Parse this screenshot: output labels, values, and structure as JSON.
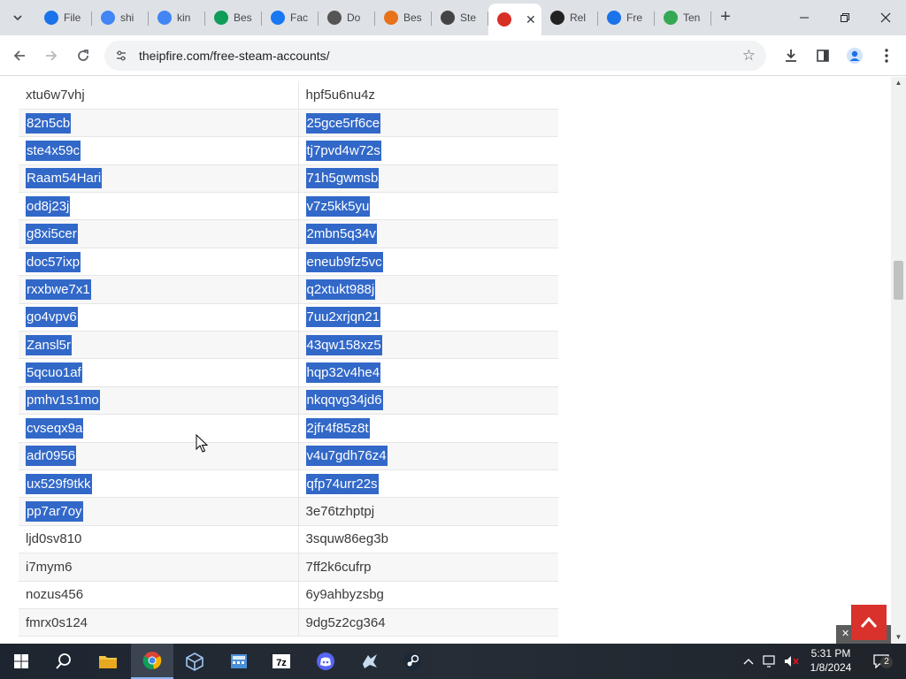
{
  "browser": {
    "tabs": [
      {
        "title": "File",
        "icon": "lightning-icon",
        "color": "#1a73e8"
      },
      {
        "title": "shi",
        "icon": "google-icon",
        "color": "#4285f4"
      },
      {
        "title": "kin",
        "icon": "google-icon",
        "color": "#4285f4"
      },
      {
        "title": "Bes",
        "icon": "app-icon",
        "color": "#0f9d58"
      },
      {
        "title": "Fac",
        "icon": "facebook-icon",
        "color": "#1877f2"
      },
      {
        "title": "Do",
        "icon": "shield-icon",
        "color": "#555555"
      },
      {
        "title": "Bes",
        "icon": "diamond-icon",
        "color": "#e8711a"
      },
      {
        "title": "Ste",
        "icon": "steam-icon",
        "color": "#444444"
      },
      {
        "title": "",
        "icon": "fire-icon",
        "color": "#d93025",
        "active": true
      },
      {
        "title": "Rel",
        "icon": "github-icon",
        "color": "#222222"
      },
      {
        "title": "Fre",
        "icon": "sms-icon",
        "color": "#1a73e8"
      },
      {
        "title": "Ten",
        "icon": "circle-icon",
        "color": "#34a853"
      }
    ],
    "url": "theipfire.com/free-steam-accounts/"
  },
  "accounts": [
    {
      "user": "xtu6w7vhj",
      "pass": "hpf5u6nu4z",
      "selected": false
    },
    {
      "user": "82n5cb",
      "pass": "25gce5rf6ce",
      "selected": true
    },
    {
      "user": "ste4x59c",
      "pass": "tj7pvd4w72s",
      "selected": true
    },
    {
      "user": "Raam54Hari",
      "pass": "71h5gwmsb",
      "selected": true
    },
    {
      "user": "od8j23j",
      "pass": "v7z5kk5yu",
      "selected": true
    },
    {
      "user": "g8xi5cer",
      "pass": "2mbn5q34v",
      "selected": true
    },
    {
      "user": "doc57ixp",
      "pass": "eneub9fz5vc",
      "selected": true
    },
    {
      "user": "rxxbwe7x1",
      "pass": "q2xtukt988j",
      "selected": true
    },
    {
      "user": "go4vpv6",
      "pass": "7uu2xrjqn21",
      "selected": true
    },
    {
      "user": "Zansl5r",
      "pass": "43qw158xz5",
      "selected": true
    },
    {
      "user": "5qcuo1af",
      "pass": "hqp32v4he4",
      "selected": true
    },
    {
      "user": "pmhv1s1mo",
      "pass": "nkqqvg34jd6",
      "selected": true
    },
    {
      "user": "cvseqx9a",
      "pass": "2jfr4f85z8t",
      "selected": true
    },
    {
      "user": "adr0956",
      "pass": "v4u7gdh76z4",
      "selected": true
    },
    {
      "user": "ux529f9tkk",
      "pass": "qfp74urr22s",
      "selected": true
    },
    {
      "user": "pp7ar7oy",
      "pass": "3e76tzhptpj",
      "selected": "user"
    },
    {
      "user": "ljd0sv810",
      "pass": "3squw86eg3b",
      "selected": false
    },
    {
      "user": "i7mym6",
      "pass": "7ff2k6cufrp",
      "selected": false
    },
    {
      "user": "nozus456",
      "pass": "6y9ahbyzsbg",
      "selected": false
    },
    {
      "user": "fmrx0s124",
      "pass": "9dg5z2cg364",
      "selected": false
    }
  ],
  "taskbar": {
    "time": "5:31 PM",
    "date": "1/8/2024",
    "notifications": "2"
  }
}
